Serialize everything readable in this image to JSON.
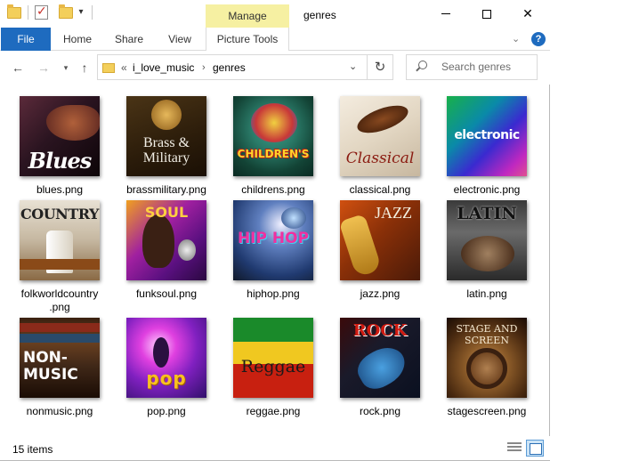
{
  "window": {
    "title": "genres",
    "context_tab_group": "Manage",
    "icons": [
      "folder-icon",
      "properties-check-icon",
      "new-folder-icon",
      "qat-dropdown-icon"
    ],
    "controls": {
      "minimize": "—",
      "maximize": "☐",
      "close": "✕"
    }
  },
  "ribbon": {
    "tabs": [
      {
        "label": "File",
        "active": true
      },
      {
        "label": "Home"
      },
      {
        "label": "Share"
      },
      {
        "label": "View"
      },
      {
        "label": "Picture Tools"
      }
    ],
    "expand_icon": "chevron-down-icon",
    "help_icon": "?"
  },
  "nav": {
    "back_icon": "←",
    "forward_icon": "→",
    "recent_icon": "⌄",
    "up_icon": "↑",
    "address": {
      "overflow": "«",
      "segments": [
        "i_love_music",
        "genres"
      ],
      "separator": "›"
    },
    "refresh_icon": "↻",
    "search": {
      "placeholder": "Search genres"
    }
  },
  "files": [
    {
      "name": "blues.png",
      "caption": "Blues"
    },
    {
      "name": "brassmilitary.png",
      "caption": "Brass & Military"
    },
    {
      "name": "childrens.png",
      "caption": "CHILDREN'S"
    },
    {
      "name": "classical.png",
      "caption": "Classical"
    },
    {
      "name": "electronic.png",
      "caption": "electronic"
    },
    {
      "name": "folkworldcountry.png",
      "caption": "COUNTRY"
    },
    {
      "name": "funksoul.png",
      "caption": "SOUL"
    },
    {
      "name": "hiphop.png",
      "caption": "HIP HOP"
    },
    {
      "name": "jazz.png",
      "caption": "JAZZ"
    },
    {
      "name": "latin.png",
      "caption": "LATIN"
    },
    {
      "name": "nonmusic.png",
      "caption": "NON-MUSIC"
    },
    {
      "name": "pop.png",
      "caption": "pop"
    },
    {
      "name": "reggae.png",
      "caption": "Reggae"
    },
    {
      "name": "rock.png",
      "caption": "ROCK"
    },
    {
      "name": "stagescreen.png",
      "caption": "STAGE AND SCREEN"
    }
  ],
  "status": {
    "item_count": "15 items",
    "views": [
      "details-view-icon",
      "large-icons-view-icon"
    ]
  },
  "colors": {
    "accent": "#1e6bbf",
    "manage_tab": "#f6f0a2",
    "selected_view": "#cce4f7"
  }
}
